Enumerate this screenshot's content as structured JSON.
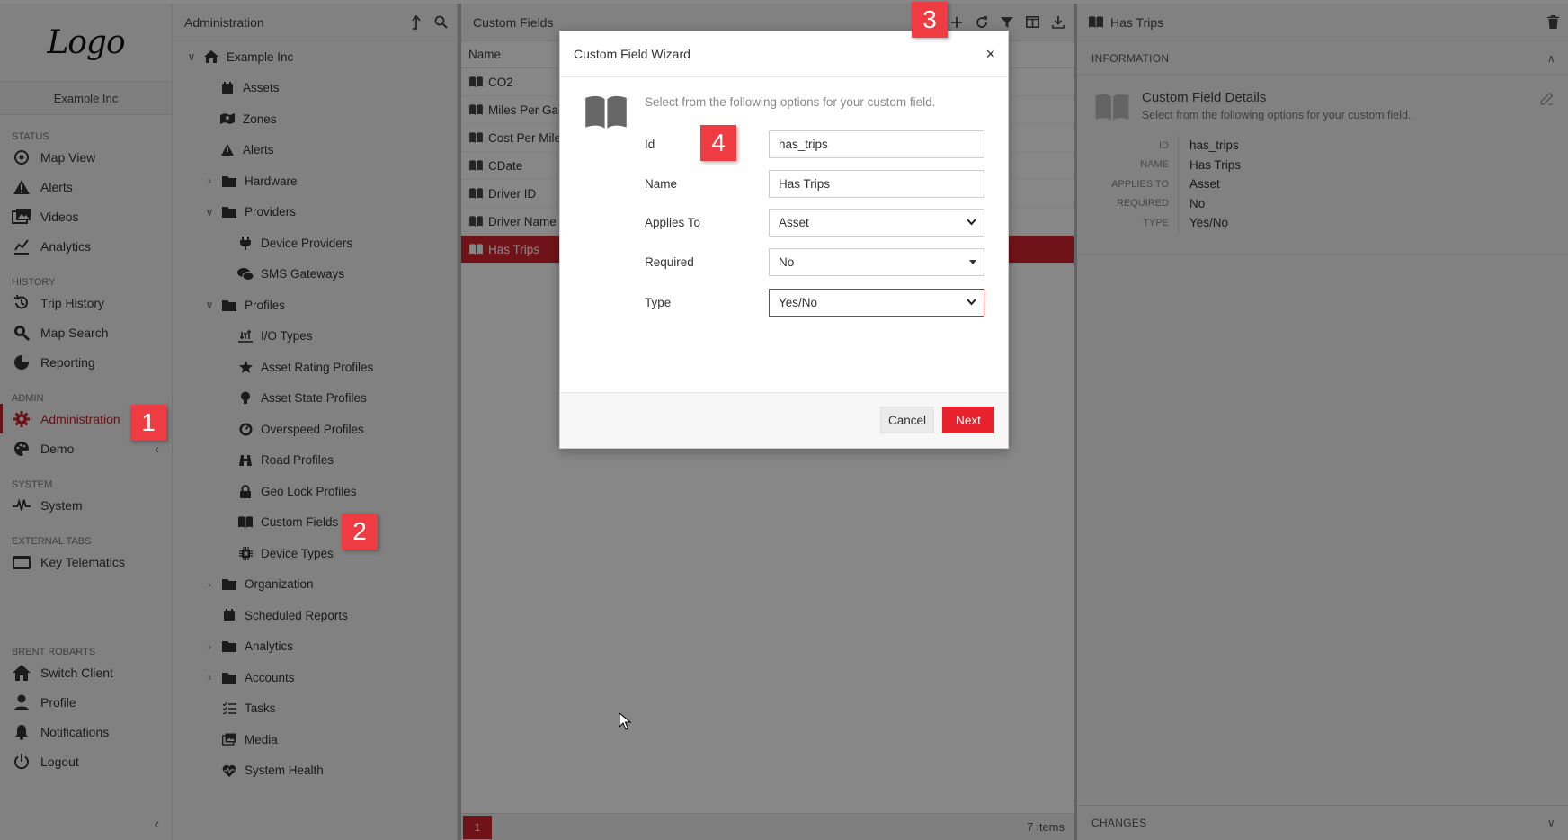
{
  "nav": {
    "logo": "Logo",
    "client": "Example Inc",
    "sections": {
      "status": "STATUS",
      "history": "HISTORY",
      "admin": "ADMIN",
      "system": "SYSTEM",
      "external": "EXTERNAL TABS",
      "user": "BRENT ROBARTS"
    },
    "items": {
      "map_view": "Map View",
      "alerts": "Alerts",
      "videos": "Videos",
      "analytics": "Analytics",
      "trip_history": "Trip History",
      "map_search": "Map Search",
      "reporting": "Reporting",
      "administration": "Administration",
      "demo": "Demo",
      "system": "System",
      "key_telematics": "Key Telematics",
      "switch_client": "Switch Client",
      "profile": "Profile",
      "notifications": "Notifications",
      "logout": "Logout"
    }
  },
  "tree": {
    "header": "Administration",
    "root": "Example Inc",
    "items": {
      "assets": "Assets",
      "zones": "Zones",
      "alerts": "Alerts",
      "hardware": "Hardware",
      "providers": "Providers",
      "device_providers": "Device Providers",
      "sms_gateways": "SMS Gateways",
      "profiles": "Profiles",
      "io_types": "I/O Types",
      "asset_rating": "Asset Rating Profiles",
      "asset_state": "Asset State Profiles",
      "overspeed": "Overspeed Profiles",
      "road": "Road Profiles",
      "geo_lock": "Geo Lock Profiles",
      "custom_fields": "Custom Fields",
      "device_types": "Device Types",
      "organization": "Organization",
      "scheduled_reports": "Scheduled Reports",
      "analytics": "Analytics",
      "accounts": "Accounts",
      "tasks": "Tasks",
      "media": "Media",
      "system_health": "System Health"
    }
  },
  "list": {
    "header": "Custom Fields",
    "column": "Name",
    "rows": [
      "CO2",
      "Miles Per Gall",
      "Cost Per Mile",
      "CDate",
      "Driver ID",
      "Driver Name",
      "Has Trips"
    ],
    "page": "1",
    "count": "7 items"
  },
  "detail": {
    "header": "Has Trips",
    "info_section": "INFORMATION",
    "card_title": "Custom Field Details",
    "card_sub": "Select from the following options for your custom field.",
    "fields": {
      "id_k": "ID",
      "id_v": "has_trips",
      "name_k": "NAME",
      "name_v": "Has Trips",
      "applies_k": "APPLIES TO",
      "applies_v": "Asset",
      "required_k": "REQUIRED",
      "required_v": "No",
      "type_k": "TYPE",
      "type_v": "Yes/No"
    },
    "changes_section": "CHANGES"
  },
  "modal": {
    "title": "Custom Field Wizard",
    "close": "×",
    "description": "Select from the following options for your custom field.",
    "id_label": "Id",
    "id_value": "has_trips",
    "name_label": "Name",
    "name_value": "Has Trips",
    "applies_label": "Applies To",
    "applies_value": "Asset",
    "required_label": "Required",
    "required_value": "No",
    "type_label": "Type",
    "type_value": "Yes/No",
    "cancel": "Cancel",
    "next": "Next"
  },
  "callouts": [
    "1",
    "2",
    "3",
    "4"
  ],
  "colors": {
    "accent": "#d32530",
    "callout": "#ef3b42"
  }
}
